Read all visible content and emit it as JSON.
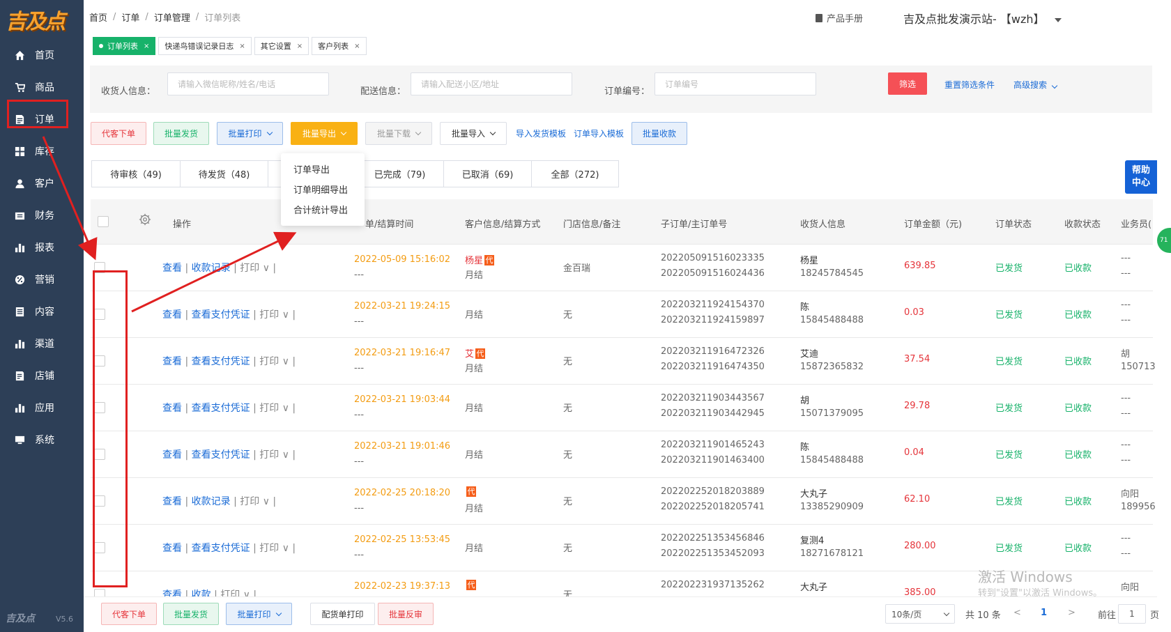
{
  "brand": {
    "logo": "吉及点",
    "version": "V5.6",
    "footer_logo": "吉及点"
  },
  "sidebar": {
    "items": [
      {
        "label": "首页",
        "icon": "home-icon"
      },
      {
        "label": "商品",
        "icon": "cart-icon"
      },
      {
        "label": "订单",
        "icon": "order-icon"
      },
      {
        "label": "库存",
        "icon": "grid-icon"
      },
      {
        "label": "客户",
        "icon": "user-icon"
      },
      {
        "label": "财务",
        "icon": "wallet-icon"
      },
      {
        "label": "报表",
        "icon": "bar-chart-icon"
      },
      {
        "label": "营销",
        "icon": "percent-icon"
      },
      {
        "label": "内容",
        "icon": "document-icon"
      },
      {
        "label": "渠道",
        "icon": "bar-chart-icon"
      },
      {
        "label": "店铺",
        "icon": "store-icon"
      },
      {
        "label": "应用",
        "icon": "bar-chart-icon"
      },
      {
        "label": "系统",
        "icon": "monitor-icon"
      }
    ]
  },
  "header": {
    "breadcrumb": [
      "首页",
      "订单",
      "订单管理",
      "订单列表"
    ],
    "manual": "产品手册",
    "site": "吉及点批发演示站-  【wzh】"
  },
  "tabs": [
    {
      "label": "订单列表",
      "active": true
    },
    {
      "label": "快递鸟错误记录日志",
      "active": false
    },
    {
      "label": "其它设置",
      "active": false
    },
    {
      "label": "客户列表",
      "active": false
    }
  ],
  "filter": {
    "receiver_label": "收货人信息：",
    "receiver_placeholder": "请输入微信昵称/姓名/电话",
    "delivery_label": "配送信息：",
    "delivery_placeholder": "请输入配送小区/地址",
    "order_no_label": "订单编号：",
    "order_no_placeholder": "订单编号",
    "filter_btn": "筛选",
    "reset": "重置筛选条件",
    "advanced": "高级搜索"
  },
  "actions": {
    "proxy_order": "代客下单",
    "batch_ship": "批量发货",
    "batch_print": "批量打印",
    "batch_export": "批量导出",
    "batch_download": "批量下载",
    "batch_import": "批量导入",
    "import_ship_template": "导入发货模板",
    "order_import_template": "订单导入模板",
    "batch_collect": "批量收款"
  },
  "export_menu": [
    "订单导出",
    "订单明细导出",
    "合计统计导出"
  ],
  "status_tabs": [
    "待审核（49)",
    "待发货（48)",
    "",
    "已完成（79)",
    "已取消（69)",
    "全部（272)"
  ],
  "help": {
    "line1": "帮助",
    "line2": "中心"
  },
  "badge": "71",
  "table": {
    "headers": {
      "ops": "操作",
      "time": "单/结算时间",
      "customer": "客户信息/结算方式",
      "store": "门店信息/备注",
      "order_no": "子订单/主订单号",
      "receiver": "收货人信息",
      "amount": "订单金额（元)",
      "status": "订单状态",
      "pay_status": "收款状态",
      "salesman": "业务员("
    },
    "rows": [
      {
        "ops": [
          "查看",
          "收款记录",
          "打印"
        ],
        "time": "2022-05-09 15:16:02",
        "time2": "---",
        "cust_name": "杨星",
        "cust_tag": "代",
        "settle": "月结",
        "store": "金百瑞",
        "sub_no": "202205091516023335",
        "main_no": "202205091516024436",
        "rname": "杨星",
        "rphone": "18245784545",
        "amount": "639.85",
        "status": "已发货",
        "pay": "已收款",
        "sales1": "---",
        "sales2": "---"
      },
      {
        "ops": [
          "查看",
          "查看支付凭证",
          "打印"
        ],
        "time": "2022-03-21 19:24:15",
        "time2": "---",
        "cust_name": "",
        "cust_tag": "",
        "settle": "月结",
        "store": "无",
        "sub_no": "202203211924154370",
        "main_no": "202203211924159897",
        "rname": "陈",
        "rphone": "15845488488",
        "amount": "0.03",
        "status": "已发货",
        "pay": "已收款",
        "sales1": "---",
        "sales2": "---"
      },
      {
        "ops": [
          "查看",
          "查看支付凭证",
          "打印"
        ],
        "time": "2022-03-21 19:16:47",
        "time2": "---",
        "cust_name": "艾",
        "cust_tag": "代",
        "settle": "月结",
        "store": "无",
        "sub_no": "202203211916472326",
        "main_no": "202203211916474350",
        "rname": "艾迪",
        "rphone": "15872365832",
        "amount": "37.54",
        "status": "已发货",
        "pay": "已收款",
        "sales1": "胡",
        "sales2": "150713"
      },
      {
        "ops": [
          "查看",
          "查看支付凭证",
          "打印"
        ],
        "time": "2022-03-21 19:03:44",
        "time2": "---",
        "cust_name": "",
        "cust_tag": "",
        "settle": "月结",
        "store": "无",
        "sub_no": "202203211903443567",
        "main_no": "202203211903442945",
        "rname": "胡",
        "rphone": "15071379095",
        "amount": "29.78",
        "status": "已发货",
        "pay": "已收款",
        "sales1": "---",
        "sales2": "---"
      },
      {
        "ops": [
          "查看",
          "查看支付凭证",
          "打印"
        ],
        "time": "2022-03-21 19:01:46",
        "time2": "---",
        "cust_name": "",
        "cust_tag": "",
        "settle": "月结",
        "store": "无",
        "sub_no": "202203211901465243",
        "main_no": "202203211901463400",
        "rname": "陈",
        "rphone": "15845488488",
        "amount": "0.04",
        "status": "已发货",
        "pay": "已收款",
        "sales1": "---",
        "sales2": "---"
      },
      {
        "ops": [
          "查看",
          "收款记录",
          "打印"
        ],
        "time": "2022-02-25 20:18:20",
        "time2": "---",
        "cust_name": "",
        "cust_tag": "代",
        "settle": "月结",
        "store": "无",
        "sub_no": "202202252018203889",
        "main_no": "202202252018205741",
        "rname": "大丸子",
        "rphone": "13385290909",
        "amount": "62.10",
        "status": "已发货",
        "pay": "已收款",
        "sales1": "向阳",
        "sales2": "189956"
      },
      {
        "ops": [
          "查看",
          "查看支付凭证",
          "打印"
        ],
        "time": "2022-02-25 13:53:45",
        "time2": "---",
        "cust_name": "",
        "cust_tag": "",
        "settle": "月结",
        "store": "无",
        "sub_no": "202202251353456846",
        "main_no": "202202251353452093",
        "rname": "复测4",
        "rphone": "18271678121",
        "amount": "280.00",
        "status": "已发货",
        "pay": "已收款",
        "sales1": "---",
        "sales2": "---"
      },
      {
        "ops": [
          "查看",
          "收款",
          "打印"
        ],
        "time": "2022-02-23 19:37:13",
        "time2": "",
        "cust_name": "",
        "cust_tag": "代",
        "settle": "",
        "store": "无",
        "sub_no": "202202231937135262",
        "main_no": "",
        "rname": "大丸子",
        "rphone": "",
        "amount": "385.00",
        "status": "",
        "pay": "",
        "sales1": "向阳",
        "sales2": ""
      }
    ]
  },
  "bottom": {
    "proxy_order": "代客下单",
    "batch_ship": "批量发货",
    "batch_print": "批量打印",
    "ship_print": "配货单打印",
    "batch_reverse": "批量反审",
    "page_size": "10条/页",
    "total": "共 10 条",
    "prev": "<",
    "page": "1",
    "next": ">",
    "goto_label": "前往",
    "goto_value": "1",
    "page_unit": "页"
  },
  "watermark": {
    "line1": "激活 Windows",
    "line2": "转到\"设置\"以激活 Windows。"
  },
  "colors": {
    "sidebar": "#2d3f57",
    "accent_blue": "#1a6bd6",
    "primary_red": "#f55056",
    "green": "#17b26a",
    "orange": "#f39c12",
    "annotation_red": "#e02020"
  }
}
